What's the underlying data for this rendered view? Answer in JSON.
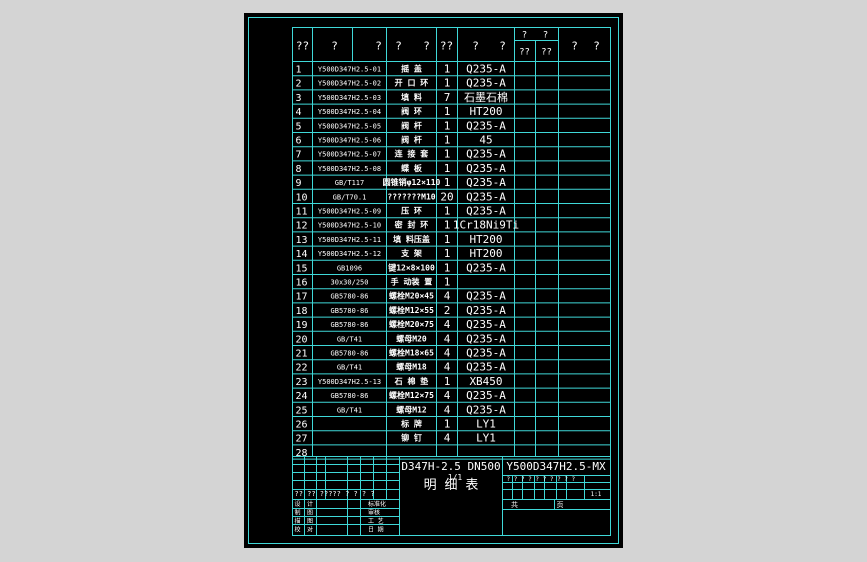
{
  "colors": {
    "background": "#d4d4d4",
    "model_space": "#000000",
    "frame": "#3fd8d8",
    "grid": "#3fd8d8",
    "text": "#ffffff"
  },
  "header": {
    "no": "??",
    "code_a": "?",
    "code_b": "?",
    "name_a": "?",
    "name_b": "?",
    "qty": "??",
    "mat_a": "?",
    "mat_b": "?",
    "weight_top_a": "?",
    "weight_top_b": "?",
    "weight_single": "??",
    "weight_total": "??",
    "remark_a": "?",
    "remark_b": "?"
  },
  "rows": [
    {
      "no": "1",
      "code": "Y500D347H2.5-01",
      "name": "摇  盖",
      "qty": "1",
      "material": "Q235-A"
    },
    {
      "no": "2",
      "code": "Y500D347H2.5-02",
      "name": "开 口 环",
      "qty": "1",
      "material": "Q235-A"
    },
    {
      "no": "3",
      "code": "Y500D347H2.5-03",
      "name": "填  料",
      "qty": "7",
      "material": "石墨石棉"
    },
    {
      "no": "4",
      "code": "Y500D347H2.5-04",
      "name": "阀  环",
      "qty": "1",
      "material": "HT200"
    },
    {
      "no": "5",
      "code": "Y500D347H2.5-05",
      "name": "阀  杆",
      "qty": "1",
      "material": "Q235-A"
    },
    {
      "no": "6",
      "code": "Y500D347H2.5-06",
      "name": "阀  杆",
      "qty": "1",
      "material": "45"
    },
    {
      "no": "7",
      "code": "Y500D347H2.5-07",
      "name": "连 接 套",
      "qty": "1",
      "material": "Q235-A"
    },
    {
      "no": "8",
      "code": "Y500D347H2.5-08",
      "name": "蝶  板",
      "qty": "1",
      "material": "Q235-A"
    },
    {
      "no": "9",
      "code": "GB/T117",
      "name": "圆锥销φ12×110",
      "qty": "1",
      "material": "Q235-A"
    },
    {
      "no": "10",
      "code": "GB/T70.1",
      "name": "???????M10",
      "qty": "20",
      "material": "Q235-A"
    },
    {
      "no": "11",
      "code": "Y500D347H2.5-09",
      "name": "压  环",
      "qty": "1",
      "material": "Q235-A"
    },
    {
      "no": "12",
      "code": "Y500D347H2.5-10",
      "name": "密 封 环",
      "qty": "1",
      "material": "1Cr18Ni9Ti"
    },
    {
      "no": "13",
      "code": "Y500D347H2.5-11",
      "name": "填 料压盖",
      "qty": "1",
      "material": "HT200"
    },
    {
      "no": "14",
      "code": "Y500D347H2.5-12",
      "name": "支  架",
      "qty": "1",
      "material": "HT200"
    },
    {
      "no": "15",
      "code": "GB1096",
      "name": "键12×8×100",
      "qty": "1",
      "material": "Q235-A"
    },
    {
      "no": "16",
      "code": "30x30/250",
      "name": "手 动装 置",
      "qty": "1",
      "material": ""
    },
    {
      "no": "17",
      "code": "GB5780-86",
      "name": "螺栓M20×45",
      "qty": "4",
      "material": "Q235-A"
    },
    {
      "no": "18",
      "code": "GB5780-86",
      "name": "螺栓M12×55",
      "qty": "2",
      "material": "Q235-A"
    },
    {
      "no": "19",
      "code": "GB5780-86",
      "name": "螺栓M20×75",
      "qty": "4",
      "material": "Q235-A"
    },
    {
      "no": "20",
      "code": "GB/T41",
      "name": "螺母M20",
      "qty": "4",
      "material": "Q235-A"
    },
    {
      "no": "21",
      "code": "GB5780-86",
      "name": "螺栓M18×65",
      "qty": "4",
      "material": "Q235-A"
    },
    {
      "no": "22",
      "code": "GB/T41",
      "name": "螺母M18",
      "qty": "4",
      "material": "Q235-A"
    },
    {
      "no": "23",
      "code": "Y500D347H2.5-13",
      "name": "石 棉 垫",
      "qty": "1",
      "material": "XB450"
    },
    {
      "no": "24",
      "code": "GB5780-86",
      "name": "螺栓M12×75",
      "qty": "4",
      "material": "Q235-A"
    },
    {
      "no": "25",
      "code": "GB/T41",
      "name": "螺母M12",
      "qty": "4",
      "material": "Q235-A"
    },
    {
      "no": "26",
      "code": "",
      "name": "标  牌",
      "qty": "1",
      "material": "LY1"
    },
    {
      "no": "27",
      "code": "",
      "name": "铆  钉",
      "qty": "4",
      "material": "LY1"
    },
    {
      "no": "28",
      "code": "",
      "name": "",
      "qty": "",
      "material": ""
    }
  ],
  "title_block": {
    "title_line1": "D347H-2.5  DN500",
    "title_line2": "明  细  表",
    "overlay_mark": "1/1",
    "drawing_no": "Y500D347H2.5-MX",
    "qmarks_row": "? ? ? ? ? ?  ? ?  ? ?",
    "scale": "1:1",
    "sheet_label": "共",
    "sheet_of": "页",
    "left_head": "?? ?? ?????   ?  ?  ? ?",
    "left_rows": [
      {
        "a": "设",
        "b": "计",
        "c": "标准化"
      },
      {
        "a": "制",
        "b": "图",
        "c": "审核"
      },
      {
        "a": "描",
        "b": "图",
        "c": "工 艺"
      },
      {
        "a": "校",
        "b": "对",
        "c": "日 期"
      }
    ]
  }
}
